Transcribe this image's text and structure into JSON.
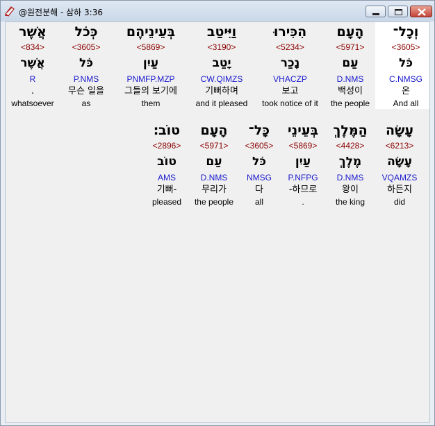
{
  "window": {
    "title": "@원전분해 - 삼하 3:36",
    "icon": "pencil-book-icon",
    "buttons": [
      "minimize-icon",
      "maximize-icon",
      "close-icon"
    ]
  },
  "colors": {
    "strong": "#8b0000",
    "parse": "#1a1acd",
    "highlight": "#ffffff"
  },
  "rows": [
    {
      "words": [
        {
          "heb": "וְכָל־",
          "strong": "<3605>",
          "lemma": "כֹּל",
          "parse": "C.NMSG",
          "kor": "온",
          "eng": "And all",
          "highlight": true
        },
        {
          "heb": "הָעָם",
          "strong": "<5971>",
          "lemma": "עַם",
          "parse": "D.NMS",
          "kor": "백성이",
          "eng": "the people"
        },
        {
          "heb": "הִכִּירוּ",
          "strong": "<5234>",
          "lemma": "נָכַר",
          "parse": "VHACZP",
          "kor": "보고",
          "eng": "took notice of it"
        },
        {
          "heb": "וַיִּיטַב",
          "strong": "<3190>",
          "lemma": "יָטַב",
          "parse": "CW.QIMZS",
          "kor": "기뻐하며",
          "eng": "and it pleased"
        },
        {
          "heb": "בְּעֵינֵיהֶם",
          "strong": "<5869>",
          "lemma": "עַיִן",
          "parse": "PNMFP.MZP",
          "kor": "그들의 보기에",
          "eng": "them"
        },
        {
          "heb": "כְּכֹל",
          "strong": "<3605>",
          "lemma": "כֹּל",
          "parse": "P.NMS",
          "kor": "무슨 일을",
          "eng": "as"
        },
        {
          "heb": "אֲשֶׁר",
          "strong": "<834>",
          "lemma": "אֲשֶׁר",
          "parse": "R",
          "kor": ".",
          "eng": "whatsoever"
        }
      ]
    },
    {
      "words": [
        {
          "heb": "עָשָׂה",
          "strong": "<6213>",
          "lemma": "עָשָׂה",
          "parse": "VQAMZS",
          "kor": "하든지",
          "eng": "did"
        },
        {
          "heb": "הַמֶּלֶךְ",
          "strong": "<4428>",
          "lemma": "מֶלֶךְ",
          "parse": "D.NMS",
          "kor": "왕이",
          "eng": "the king"
        },
        {
          "heb": "בְּעֵינֵי",
          "strong": "<5869>",
          "lemma": "עַיִן",
          "parse": "P.NFPG",
          "kor": "-하므로",
          "eng": "."
        },
        {
          "heb": "כָּל־",
          "strong": "<3605>",
          "lemma": "כֹּל",
          "parse": "NMSG",
          "kor": "다",
          "eng": "all"
        },
        {
          "heb": "הָעָם",
          "strong": "<5971>",
          "lemma": "עַם",
          "parse": "D.NMS",
          "kor": "무리가",
          "eng": "the people"
        },
        {
          "heb": "טוֹב׃",
          "strong": "<2896>",
          "lemma": "טוֹב",
          "parse": "AMS",
          "kor": "기뻐-",
          "eng": "pleased"
        }
      ]
    }
  ]
}
